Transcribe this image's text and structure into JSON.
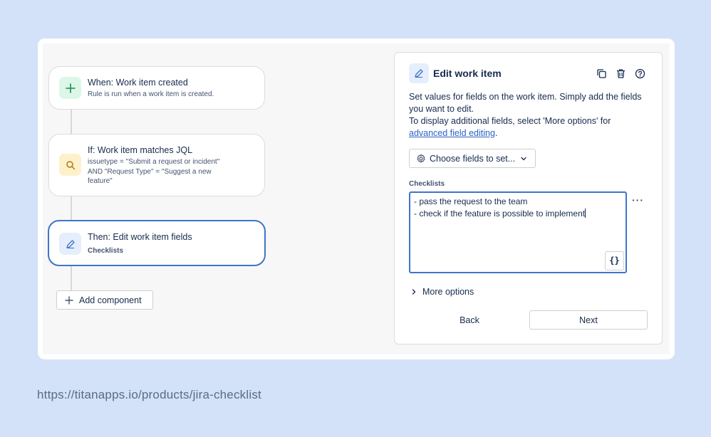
{
  "flow": {
    "trigger": {
      "title": "When: Work item created",
      "subtitle": "Rule is run when a work item is created."
    },
    "condition": {
      "title": "If: Work item matches JQL",
      "subtitle_lines": [
        "issuetype = \"Submit a request or incident\"",
        "AND \"Request Type\" = \"Suggest a new",
        "feature\""
      ]
    },
    "action": {
      "title": "Then: Edit work item fields",
      "subtitle": "Checklists"
    },
    "add_component_label": "Add component"
  },
  "panel": {
    "title": "Edit work item",
    "description_line1": "Set values for fields on the work item. Simply add the fields you want to edit.",
    "description_line2": "To display additional fields, select 'More options' for",
    "advanced_link": "advanced field editing",
    "advanced_suffix": ".",
    "choose_fields_label": "Choose fields to set...",
    "field_label": "Checklists",
    "field_lines": [
      "- pass the request to the team",
      "- check if the feature is possible to implement"
    ],
    "braces_label": "{}",
    "more_options_label": "More options",
    "back_label": "Back",
    "next_label": "Next",
    "icons": [
      "pencil-icon",
      "copy-icon",
      "trash-icon",
      "help-icon",
      "gear-icon",
      "chevron-down-icon",
      "chevron-right-icon",
      "more-icon"
    ]
  },
  "footer_url": "https://titanapps.io/products/jira-checklist",
  "colors": {
    "background": "#d3e2f8",
    "accent": "#3f74c8",
    "link": "#2a63c7",
    "trigger_icon_bg": "#dcf7e8",
    "condition_icon_bg": "#fdf1cc",
    "action_icon_bg": "#e4eefc"
  }
}
